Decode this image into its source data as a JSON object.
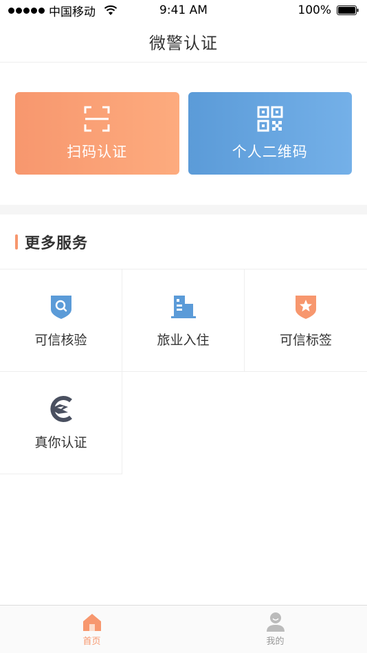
{
  "status_bar": {
    "carrier": "中国移动",
    "time": "9:41 AM",
    "battery": "100%"
  },
  "nav": {
    "title": "微警认证"
  },
  "hero": {
    "scan_label": "扫码认证",
    "qr_label": "个人二维码"
  },
  "section": {
    "title": "更多服务"
  },
  "services": [
    {
      "label": "可信核验",
      "icon": "shield-search-icon",
      "color": "#5b9bd8"
    },
    {
      "label": "旅业入住",
      "icon": "building-icon",
      "color": "#5b9bd8"
    },
    {
      "label": "可信标签",
      "icon": "shield-star-icon",
      "color": "#f7976e"
    },
    {
      "label": "真你认证",
      "icon": "eagle-logo-icon",
      "color": "#4a5060"
    }
  ],
  "tabs": [
    {
      "label": "首页",
      "icon": "home-icon",
      "active": true
    },
    {
      "label": "我的",
      "icon": "user-icon",
      "active": false
    }
  ],
  "colors": {
    "accent_orange": "#f7976e",
    "accent_blue": "#5b9bd8"
  }
}
